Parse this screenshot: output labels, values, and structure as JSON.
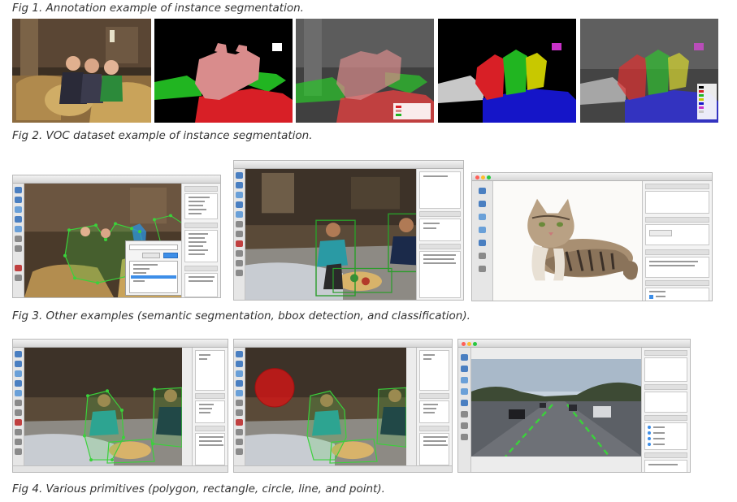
{
  "captions": {
    "fig1": "Fig 1. Annotation example of instance segmentation.",
    "fig2": "Fig 2. VOC dataset example of instance segmentation.",
    "fig3": "Fig 3. Other examples (semantic segmentation, bbox detection, and classification).",
    "fig4": "Fig 4. Various primitives (polygon, rectangle, circle, line, and point)."
  },
  "colors": {
    "person_mask": "#d98c8c",
    "chair_green": "#21b521",
    "sofa_red": "#d81f26",
    "instance_blue": "#1515c8",
    "instance_yellow": "#c8c800",
    "instance_magenta": "#c832c8",
    "polygon_green": "#3bd13b",
    "circle_red": "#d51515",
    "bbox_green": "#2a9d2a",
    "window_chrome": "#ececec"
  },
  "icons": [
    "traffic-light-icons",
    "tool-icons",
    "checkbox-icons",
    "polygon-vertex-icons"
  ]
}
